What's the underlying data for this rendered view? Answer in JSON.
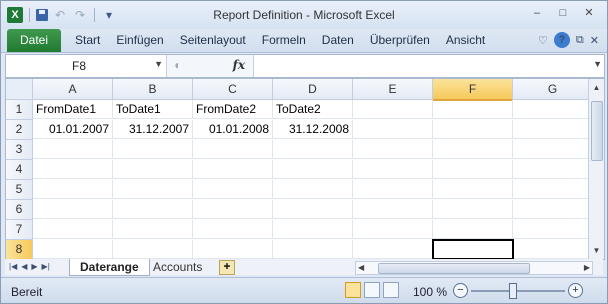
{
  "window": {
    "title": "Report Definition  -  Microsoft Excel",
    "app_logo": "X",
    "controls": [
      "–",
      "□",
      "✕"
    ]
  },
  "qat": {
    "undo": "↶",
    "redo": "↷",
    "customize": "▾"
  },
  "ribbon": {
    "file_tab": "Datei",
    "tabs": [
      "Start",
      "Einfügen",
      "Seitenlayout",
      "Formeln",
      "Daten",
      "Überprüfen",
      "Ansicht"
    ],
    "icons": {
      "minimize_ribbon": "♡",
      "help": "?",
      "restore_doc": "⧉",
      "close_doc": "✕"
    }
  },
  "formula_bar": {
    "name_box": "F8",
    "fx": "fx",
    "formula": ""
  },
  "grid": {
    "columns": [
      "A",
      "B",
      "C",
      "D",
      "E",
      "F",
      "G"
    ],
    "rows": [
      "1",
      "2",
      "3",
      "4",
      "5",
      "6",
      "7",
      "8"
    ],
    "selected_column": "F",
    "selected_row": "8",
    "cells": {
      "A1": "FromDate1",
      "B1": "ToDate1",
      "C1": "FromDate2",
      "D1": "ToDate2",
      "A2": "01.01.2007",
      "B2": "31.12.2007",
      "C2": "01.01.2008",
      "D2": "31.12.2008"
    }
  },
  "sheets": {
    "nav": [
      "|◀",
      "◀",
      "▶",
      "▶|"
    ],
    "tabs": [
      "Daterange",
      "Accounts"
    ],
    "active": "Daterange"
  },
  "statusbar": {
    "mode": "Bereit",
    "zoom": "100 %",
    "zoom_minus": "−",
    "zoom_plus": "+",
    "zoom_level": 1.0
  }
}
